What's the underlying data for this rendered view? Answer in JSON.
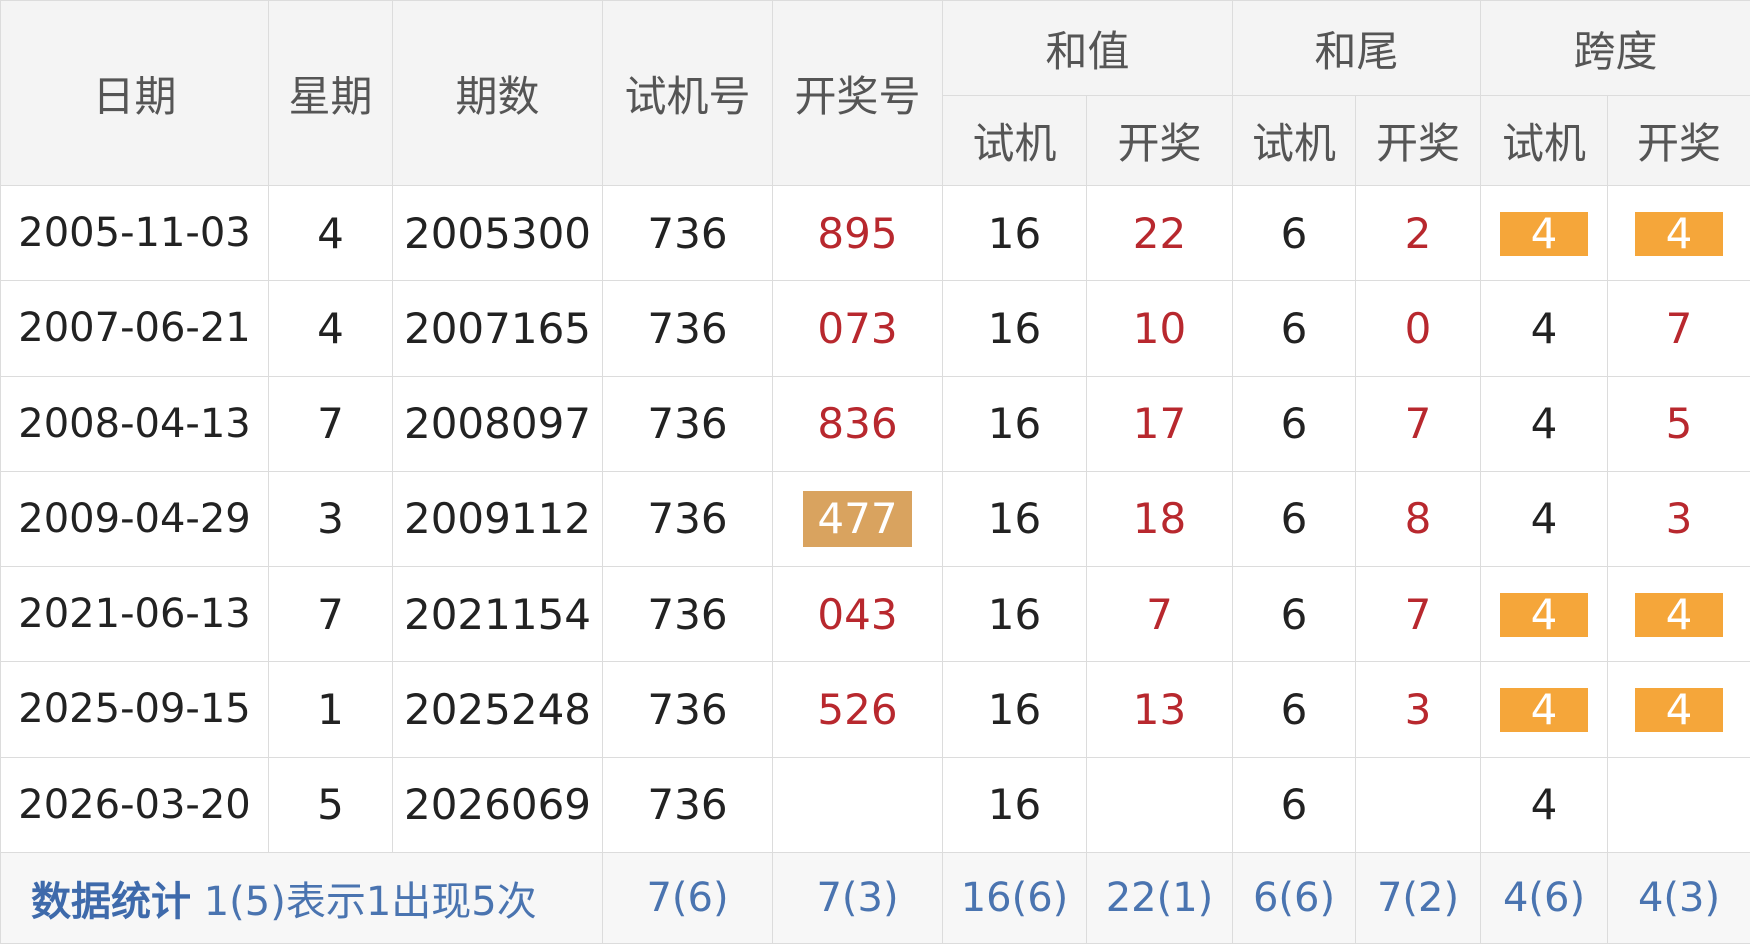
{
  "header": {
    "date": "日期",
    "weekday": "星期",
    "issue": "期数",
    "trial": "试机号",
    "draw": "开奖号",
    "sum": "和值",
    "tail": "和尾",
    "span": "跨度",
    "sub_trial": "试机",
    "sub_draw": "开奖"
  },
  "rows": [
    {
      "date": "2005-11-03",
      "weekday": "4",
      "issue": "2005300",
      "trial": "736",
      "draw": "895",
      "sum_trial": "16",
      "sum_draw": "22",
      "tail_trial": "6",
      "tail_draw": "2",
      "span_trial": "4",
      "span_draw": "4"
    },
    {
      "date": "2007-06-21",
      "weekday": "4",
      "issue": "2007165",
      "trial": "736",
      "draw": "073",
      "sum_trial": "16",
      "sum_draw": "10",
      "tail_trial": "6",
      "tail_draw": "0",
      "span_trial": "4",
      "span_draw": "7"
    },
    {
      "date": "2008-04-13",
      "weekday": "7",
      "issue": "2008097",
      "trial": "736",
      "draw": "836",
      "sum_trial": "16",
      "sum_draw": "17",
      "tail_trial": "6",
      "tail_draw": "7",
      "span_trial": "4",
      "span_draw": "5"
    },
    {
      "date": "2009-04-29",
      "weekday": "3",
      "issue": "2009112",
      "trial": "736",
      "draw": "477",
      "sum_trial": "16",
      "sum_draw": "18",
      "tail_trial": "6",
      "tail_draw": "8",
      "span_trial": "4",
      "span_draw": "3"
    },
    {
      "date": "2021-06-13",
      "weekday": "7",
      "issue": "2021154",
      "trial": "736",
      "draw": "043",
      "sum_trial": "16",
      "sum_draw": "7",
      "tail_trial": "6",
      "tail_draw": "7",
      "span_trial": "4",
      "span_draw": "4"
    },
    {
      "date": "2025-09-15",
      "weekday": "1",
      "issue": "2025248",
      "trial": "736",
      "draw": "526",
      "sum_trial": "16",
      "sum_draw": "13",
      "tail_trial": "6",
      "tail_draw": "3",
      "span_trial": "4",
      "span_draw": "4"
    },
    {
      "date": "2026-03-20",
      "weekday": "5",
      "issue": "2026069",
      "trial": "736",
      "draw": "",
      "sum_trial": "16",
      "sum_draw": "",
      "tail_trial": "6",
      "tail_draw": "",
      "span_trial": "4",
      "span_draw": ""
    }
  ],
  "stats": {
    "title": "数据统计",
    "note": " 1(5)表示1出现5次",
    "trial": "7(6)",
    "draw": "7(3)",
    "sum_trial": "16(6)",
    "sum_draw": "22(1)",
    "tail_trial": "6(6)",
    "tail_draw": "7(2)",
    "span_trial": "4(6)",
    "span_draw": "4(3)"
  },
  "colors": {
    "header_bg": "#f4f4f4",
    "draw_red": "#b8282e",
    "highlight_gold": "#d9a35f",
    "highlight_orange": "#f5a63a",
    "stats_blue": "#4a74b0"
  }
}
